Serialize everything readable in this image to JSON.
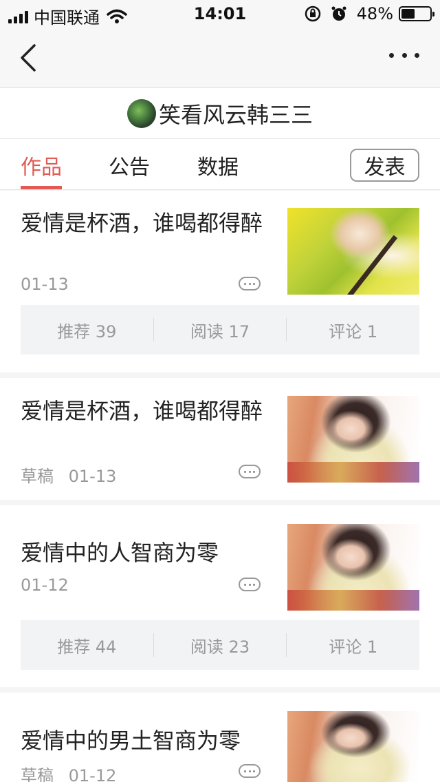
{
  "status_bar": {
    "carrier": "中国联通",
    "time": "14:01",
    "battery_text": "48%",
    "battery_level": 0.48
  },
  "profile": {
    "name": "笑看风云韩三三"
  },
  "tabs": [
    {
      "label": "作品",
      "active": true
    },
    {
      "label": "公告",
      "active": false
    },
    {
      "label": "数据",
      "active": false
    }
  ],
  "publish_label": "发表",
  "articles": [
    {
      "title": "爱情是杯酒，谁喝都得醉",
      "draft": "",
      "date": "01-13",
      "image": "woman-with-cello-in-flower-field",
      "stats": {
        "recommend": "推荐 39",
        "read": "阅读 17",
        "comment": "评论 1"
      }
    },
    {
      "title": "爱情是杯酒，谁喝都得醉",
      "draft": "草稿",
      "date": "01-13",
      "image": "woman-sitting-by-window"
    },
    {
      "title": "爱情中的人智商为零",
      "draft": "",
      "date": "01-12",
      "image": "woman-sitting-by-window",
      "stats": {
        "recommend": "推荐 44",
        "read": "阅读 23",
        "comment": "评论 1"
      }
    },
    {
      "title": "爱情中的男土智商为零",
      "draft": "草稿",
      "date": "01-12",
      "image": "woman-sitting-by-window"
    }
  ],
  "colors": {
    "accent": "#e25a53",
    "muted": "#999999",
    "stats_bg": "#f2f3f5"
  },
  "icons": {
    "back": "chevron-left-icon",
    "more": "more-dots-icon",
    "wifi": "wifi-icon",
    "alarm": "alarm-icon",
    "lock": "rotation-lock-icon"
  }
}
